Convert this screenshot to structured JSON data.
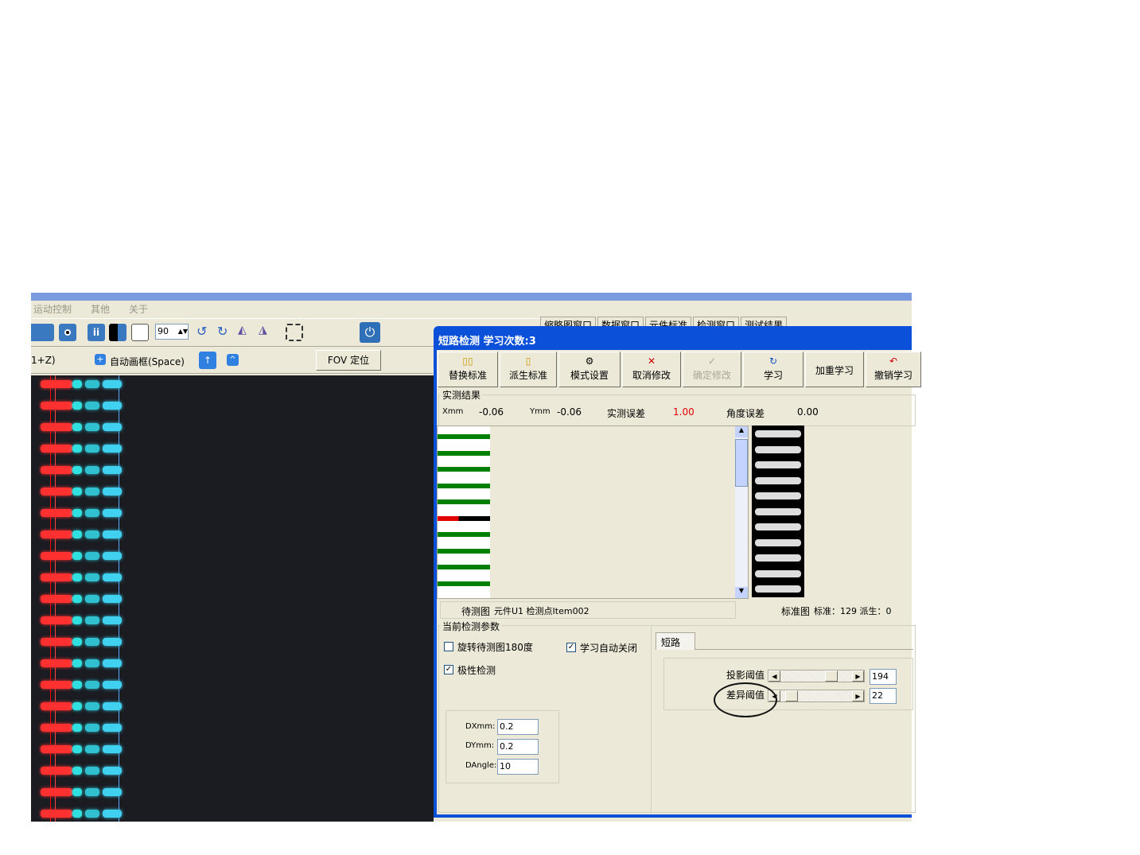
{
  "menu": {
    "items": [
      "运动控制",
      "其他",
      "关于"
    ]
  },
  "toolbar": {
    "angle_value": "90"
  },
  "row2": {
    "shortcut_text": "1+Z)",
    "auto_frame_label": "自动画框(Space)",
    "fov_button": "FOV 定位"
  },
  "right_tabs": [
    "缩略图窗口",
    "数据窗口",
    "元件标准",
    "检测窗口",
    "测试结果"
  ],
  "dialog": {
    "title": "短路检测  学习次数:3",
    "buttons": [
      "替换标准",
      "派生标准",
      "模式设置",
      "取消修改",
      "确定修改",
      "学习",
      "加重学习",
      "撤销学习"
    ],
    "results": {
      "group_label": "实测结果",
      "xmm_label": "Xmm",
      "xmm": "-0.06",
      "ymm_label": "Ymm",
      "ymm": "-0.06",
      "err_label": "实测误差",
      "err": "1.00",
      "angle_label": "角度误差",
      "angle": "0.00"
    },
    "status": {
      "test_label": "待测图",
      "test_info": "元件U1 检测点Item002",
      "std_label": "标准图",
      "std_info": "标准：129 派生：0"
    },
    "params": {
      "group_label": "当前检测参数",
      "rotate_label": "旋转待测图180度",
      "rotate_checked": false,
      "auto_close_label": "学习自动关闭",
      "auto_close_checked": true,
      "polarity_label": "极性检测",
      "polarity_checked": true,
      "dx_label": "DXmm:",
      "dx": "0.2",
      "dy_label": "DYmm:",
      "dy": "0.2",
      "dangle_label": "DAngle:",
      "dangle": "10",
      "tab_label": "短路",
      "proj_label": "投影阈值",
      "proj_value": "194",
      "diff_label": "差异阈值",
      "diff_value": "22",
      "slider_max": 255
    },
    "colors": {
      "title": "#0a50d8",
      "error": "#e00000",
      "graph_ok": "#008000",
      "graph_bad": "#e00000"
    }
  }
}
